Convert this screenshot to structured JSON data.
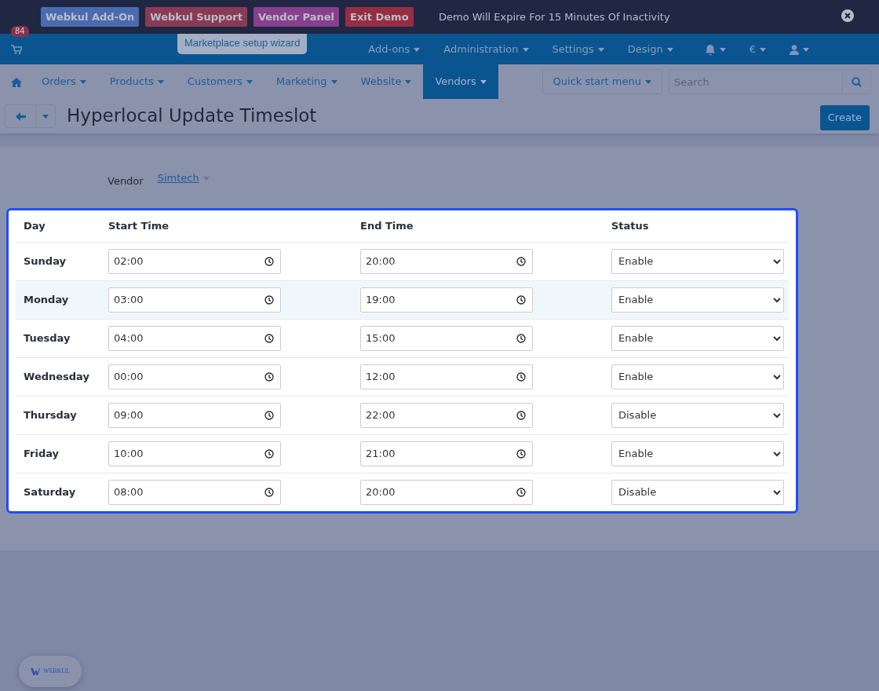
{
  "demo_bar": {
    "buttons": [
      {
        "label": "Webkul Add-On",
        "color": "#4b6bb0"
      },
      {
        "label": "Webkul Support",
        "color": "#8a3b53"
      },
      {
        "label": "Vendor Panel",
        "color": "#883f8e"
      },
      {
        "label": "Exit Demo",
        "color": "#972d41"
      }
    ],
    "message": "Demo Will Expire For 15 Minutes Of Inactivity"
  },
  "top_nav": {
    "tooltip": "Marketplace setup wizard",
    "menus": [
      "Add-ons",
      "Administration",
      "Settings",
      "Design"
    ],
    "notification_count": "84",
    "currency": "€"
  },
  "main_nav": {
    "items": [
      {
        "label": "Orders",
        "selected": false
      },
      {
        "label": "Products",
        "selected": false
      },
      {
        "label": "Customers",
        "selected": false
      },
      {
        "label": "Marketing",
        "selected": false
      },
      {
        "label": "Website",
        "selected": false
      },
      {
        "label": "Vendors",
        "selected": true
      }
    ],
    "quick_start": "Quick start menu",
    "search": {
      "placeholder": "Search"
    }
  },
  "page": {
    "title": "Hyperlocal Update Timeslot",
    "create_button": "Create",
    "vendor_label": "Vendor",
    "vendor_value": "Simtech"
  },
  "table": {
    "columns": [
      "Day",
      "Start Time",
      "End Time",
      "Status"
    ],
    "rows": [
      {
        "day": "Sunday",
        "start": "02:00",
        "end": "20:00",
        "status": "Enable",
        "hovered": false
      },
      {
        "day": "Monday",
        "start": "03:00",
        "end": "19:00",
        "status": "Enable",
        "hovered": true
      },
      {
        "day": "Tuesday",
        "start": "04:00",
        "end": "15:00",
        "status": "Enable",
        "hovered": false
      },
      {
        "day": "Wednesday",
        "start": "00:00",
        "end": "12:00",
        "status": "Enable",
        "hovered": false
      },
      {
        "day": "Thursday",
        "start": "09:00",
        "end": "22:00",
        "status": "Disable",
        "hovered": false
      },
      {
        "day": "Friday",
        "start": "10:00",
        "end": "21:00",
        "status": "Enable",
        "hovered": false
      },
      {
        "day": "Saturday",
        "start": "08:00",
        "end": "20:00",
        "status": "Disable",
        "hovered": false
      }
    ]
  },
  "footer_badge": {
    "logo_text": "WEBKUL"
  }
}
